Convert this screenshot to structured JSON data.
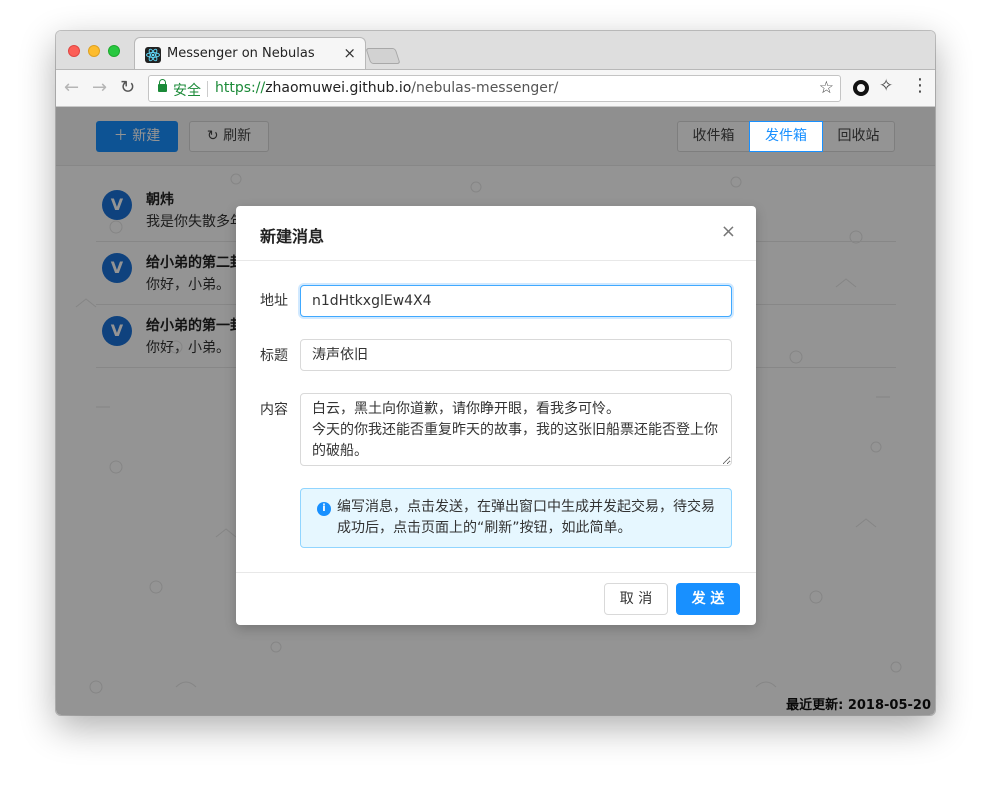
{
  "browser": {
    "tab_title": "Messenger on Nebulas",
    "tab_close": "×",
    "secure_label": "安全",
    "url_scheme": "https://",
    "url_host": "zhaomuwei.github.io",
    "url_path": "/nebulas-messenger/",
    "icons": {
      "back": "←",
      "forward": "→",
      "reload": "↻",
      "star": "☆",
      "sparkle": "✧",
      "menu": "⋮"
    }
  },
  "header": {
    "new_button": "＋ 新建",
    "refresh_button": "↻ 刷新",
    "tabs": [
      "收件箱",
      "发件箱",
      "回收站"
    ],
    "active_tab": "发件箱"
  },
  "messages": [
    {
      "avatar": "V",
      "title": "朝炜",
      "body": "我是你失散多年"
    },
    {
      "avatar": "V",
      "title": "给小弟的第二封",
      "body": "你好，小弟。"
    },
    {
      "avatar": "V",
      "title": "给小弟的第一封",
      "body": "你好，小弟。"
    }
  ],
  "footer": {
    "updated": "最近更新: 2018-05-20"
  },
  "modal": {
    "title": "新建消息",
    "close": "×",
    "address_label": "地址",
    "address_value": "n1dHtkxglEw4X4",
    "subject_label": "标题",
    "subject_value": "涛声依旧",
    "content_label": "内容",
    "content_value": "白云，黑土向你道歉，请你睁开眼，看我多可怜。\n今天的你我还能否重复昨天的故事，我的这张旧船票还能否登上你的破船。",
    "alert_icon": "i",
    "alert_text": "编写消息，点击发送，在弹出窗口中生成并发起交易，待交易成功后，点击页面上的“刷新”按钮，如此简单。",
    "cancel_button": "取 消",
    "send_button": "发 送"
  },
  "colors": {
    "primary": "#1890ff",
    "secure_green": "#1b8a38",
    "avatar_blue": "#1a73d9"
  }
}
